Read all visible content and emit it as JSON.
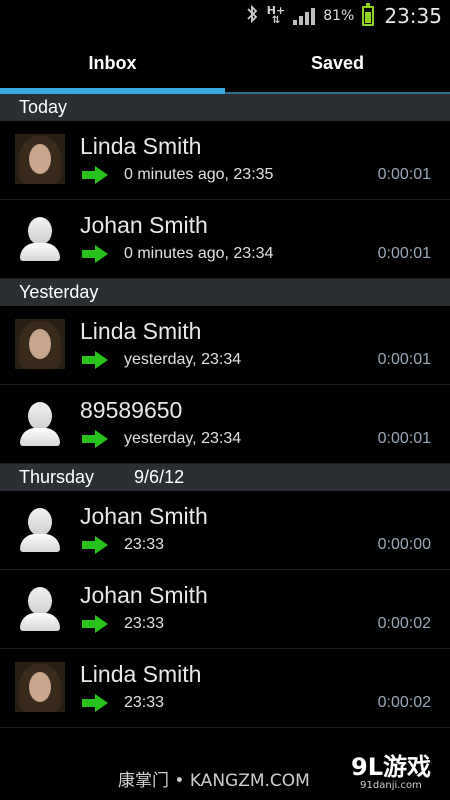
{
  "status_bar": {
    "network": "H+",
    "battery_percent": "81%",
    "time": "23:35",
    "icons": [
      "bluetooth-icon",
      "data-arrows-icon",
      "signal-icon",
      "battery-icon"
    ],
    "battery_level": 0.81
  },
  "tabs": [
    {
      "label": "Inbox",
      "active": true
    },
    {
      "label": "Saved",
      "active": false
    }
  ],
  "sections": [
    {
      "title": "Today",
      "date": "",
      "items": [
        {
          "name": "Linda Smith",
          "time": "0 minutes ago, 23:35",
          "duration": "0:00:01",
          "avatar": "photo"
        },
        {
          "name": "Johan Smith",
          "time": "0 minutes ago, 23:34",
          "duration": "0:00:01",
          "avatar": "default"
        }
      ]
    },
    {
      "title": "Yesterday",
      "date": "",
      "items": [
        {
          "name": "Linda Smith",
          "time": "yesterday, 23:34",
          "duration": "0:00:01",
          "avatar": "photo"
        },
        {
          "name": "89589650",
          "time": "yesterday, 23:34",
          "duration": "0:00:01",
          "avatar": "default"
        }
      ]
    },
    {
      "title": "Thursday",
      "date": "9/6/12",
      "items": [
        {
          "name": "Johan Smith",
          "time": "23:33",
          "duration": "0:00:00",
          "avatar": "default"
        },
        {
          "name": "Johan Smith",
          "time": "23:33",
          "duration": "0:00:02",
          "avatar": "default"
        },
        {
          "name": "Linda Smith",
          "time": "23:33",
          "duration": "0:00:02",
          "avatar": "photo"
        }
      ]
    }
  ],
  "colors": {
    "accent": "#35a9e0",
    "section_bg": "#2b2f33",
    "arrow_green": "#27c21c",
    "duration_text": "#9aa8b8"
  },
  "watermarks": {
    "left": "康掌门 • KANGZM.COM",
    "right_big": "9L游戏",
    "right_small": "91danji.com"
  }
}
